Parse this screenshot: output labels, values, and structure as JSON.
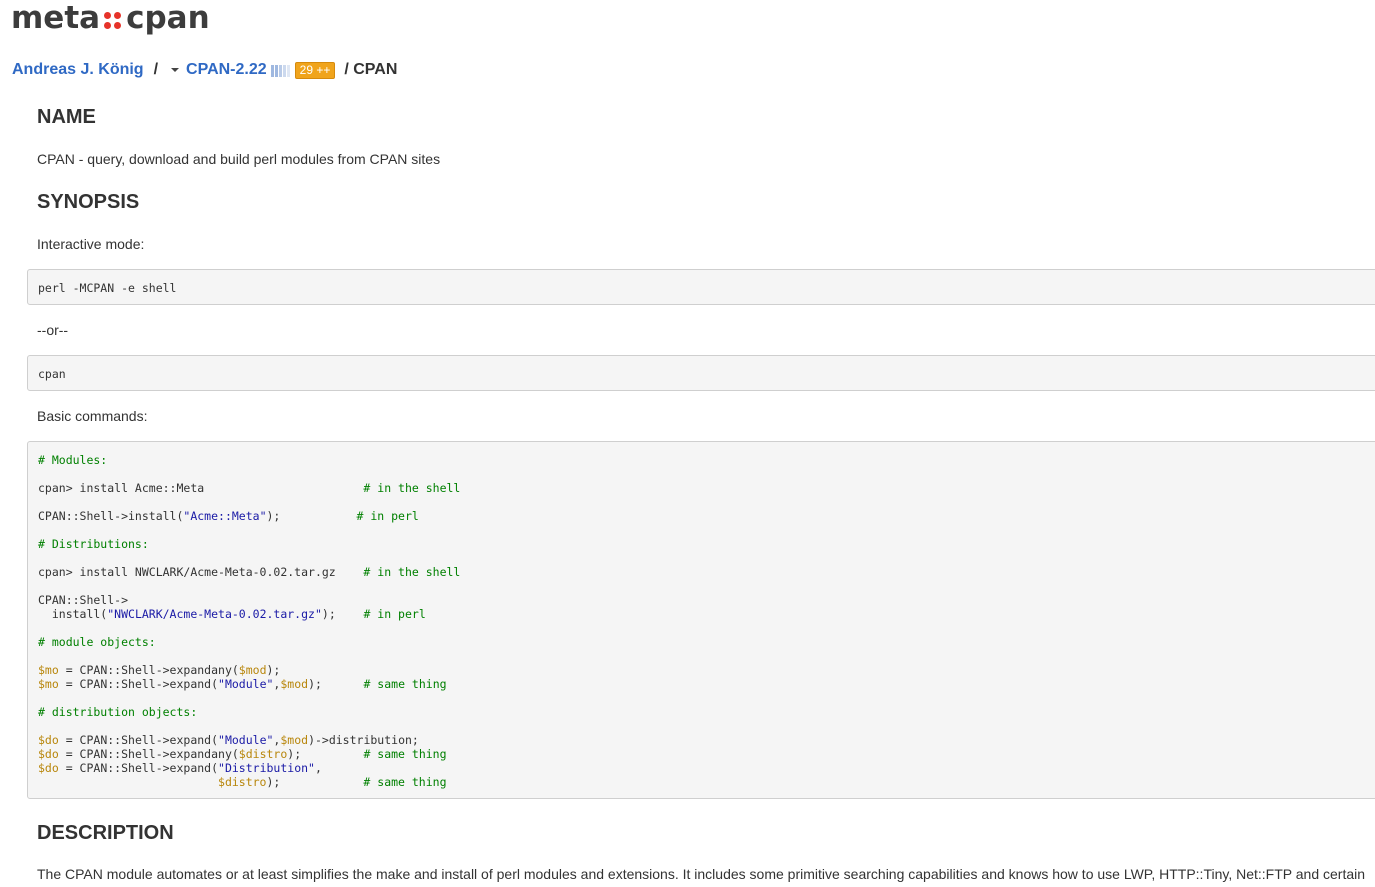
{
  "logo": {
    "left": "meta",
    "right": "cpan",
    "dot_color": "#e6332a"
  },
  "breadcrumb": {
    "author": "Andreas J. König",
    "separator": "/",
    "release": "CPAN-2.22",
    "plusplus": "29 ++",
    "module": "/ CPAN"
  },
  "kwalitee_colors": [
    "#9fb8e0",
    "#9fb8e0",
    "#b9cbe8",
    "#ccd9ee",
    "#dfe7f4"
  ],
  "sections": {
    "name_heading": "NAME",
    "name_text": "CPAN - query, download and build perl modules from CPAN sites",
    "synopsis_heading": "SYNOPSIS",
    "interactive_label": "Interactive mode:",
    "code1": "perl -MCPAN -e shell",
    "or_text": "--or--",
    "code2": "cpan",
    "basic_label": "Basic commands:",
    "description_heading": "DESCRIPTION",
    "description_text": "The CPAN module automates or at least simplifies the make and install of perl modules and extensions. It includes some primitive searching capabilities and knows how to use LWP, HTTP::Tiny, Net::FTP and certain"
  },
  "code_block": [
    [
      [
        "cm",
        "# Modules:"
      ]
    ],
    [
      [
        "",
        ""
      ]
    ],
    [
      [
        "",
        "cpan> install Acme::Meta                       "
      ],
      [
        "cm",
        "# in the shell"
      ]
    ],
    [
      [
        "",
        ""
      ]
    ],
    [
      [
        "",
        "CPAN::Shell->install("
      ],
      [
        "st",
        "\"Acme::Meta\""
      ],
      [
        "",
        ");           "
      ],
      [
        "cm",
        "# in perl"
      ]
    ],
    [
      [
        "",
        ""
      ]
    ],
    [
      [
        "cm",
        "# Distributions:"
      ]
    ],
    [
      [
        "",
        ""
      ]
    ],
    [
      [
        "",
        "cpan> install NWCLARK/Acme-Meta-0.02.tar.gz    "
      ],
      [
        "cm",
        "# in the shell"
      ]
    ],
    [
      [
        "",
        ""
      ]
    ],
    [
      [
        "",
        "CPAN::Shell->"
      ]
    ],
    [
      [
        "",
        "  install("
      ],
      [
        "st",
        "\"NWCLARK/Acme-Meta-0.02.tar.gz\""
      ],
      [
        "",
        ");    "
      ],
      [
        "cm",
        "# in perl"
      ]
    ],
    [
      [
        "",
        ""
      ]
    ],
    [
      [
        "cm",
        "# module objects:"
      ]
    ],
    [
      [
        "",
        ""
      ]
    ],
    [
      [
        "vr",
        "$mo"
      ],
      [
        "",
        " = CPAN::Shell->expandany("
      ],
      [
        "vr",
        "$mod"
      ],
      [
        "",
        ");"
      ]
    ],
    [
      [
        "vr",
        "$mo"
      ],
      [
        "",
        " = CPAN::Shell->expand("
      ],
      [
        "st",
        "\"Module\""
      ],
      [
        "",
        ","
      ],
      [
        "vr",
        "$mod"
      ],
      [
        "",
        ");      "
      ],
      [
        "cm",
        "# same thing"
      ]
    ],
    [
      [
        "",
        ""
      ]
    ],
    [
      [
        "cm",
        "# distribution objects:"
      ]
    ],
    [
      [
        "",
        ""
      ]
    ],
    [
      [
        "vr",
        "$do"
      ],
      [
        "",
        " = CPAN::Shell->expand("
      ],
      [
        "st",
        "\"Module\""
      ],
      [
        "",
        ","
      ],
      [
        "vr",
        "$mod"
      ],
      [
        "",
        ")->distribution;"
      ]
    ],
    [
      [
        "vr",
        "$do"
      ],
      [
        "",
        " = CPAN::Shell->expandany("
      ],
      [
        "vr",
        "$distro"
      ],
      [
        "",
        ");         "
      ],
      [
        "cm",
        "# same thing"
      ]
    ],
    [
      [
        "vr",
        "$do"
      ],
      [
        "",
        " = CPAN::Shell->expand("
      ],
      [
        "st",
        "\"Distribution\""
      ],
      [
        "",
        ","
      ]
    ],
    [
      [
        "",
        "                          "
      ],
      [
        "vr",
        "$distro"
      ],
      [
        "",
        ");            "
      ],
      [
        "cm",
        "# same thing"
      ]
    ]
  ]
}
